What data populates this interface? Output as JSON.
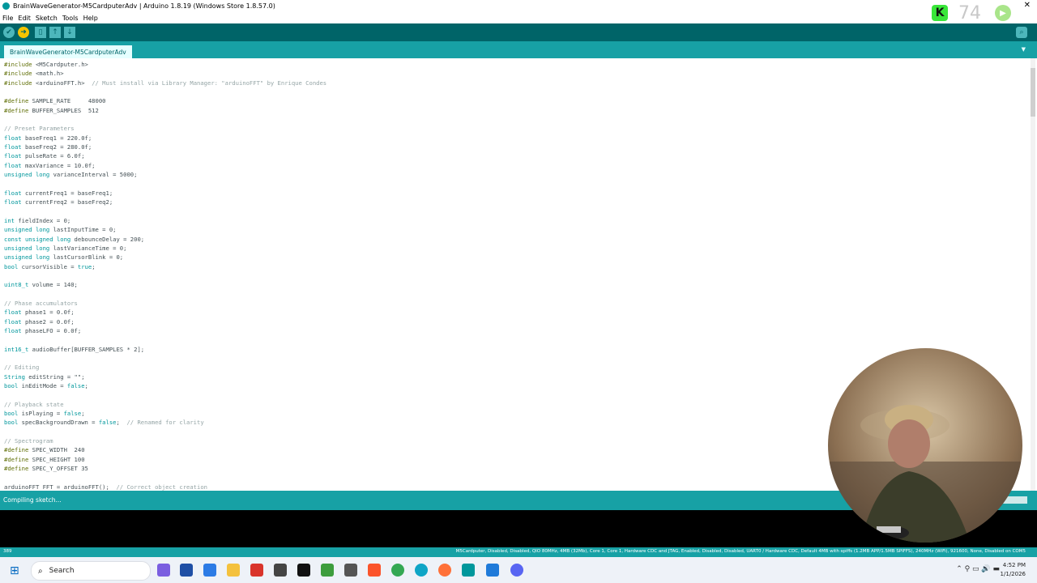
{
  "window": {
    "title": "BrainWaveGenerator-M5CardputerAdv | Arduino 1.8.19 (Windows Store 1.8.57.0)",
    "close_glyph": "✕"
  },
  "menu": [
    "File",
    "Edit",
    "Sketch",
    "Tools",
    "Help"
  ],
  "overlay": {
    "k_label": "K",
    "number": "74"
  },
  "tab": {
    "label": "BrainWaveGenerator-M5CardputerAdv"
  },
  "status": {
    "message": "Compiling sketch..."
  },
  "board_bar": {
    "line": "389",
    "info": "M5Cardputer, Disabled, Disabled, QIO 80MHz, 4MB (32Mb), Core 1, Core 1, Hardware CDC and JTAG, Enabled, Disabled, Disabled, UART0 / Hardware CDC, Default 4MB with spiffs (1.2MB APP/1.5MB SPIFFS), 240MHz (WiFi), 921600, None, Disabled on COM5"
  },
  "taskbar": {
    "search_label": "Search",
    "time": "4:52 PM",
    "date": "1/1/2026"
  },
  "colors": {
    "toolbar": "#006468",
    "tabbar": "#17a1a5",
    "accent": "#00979c",
    "preprocessor": "#5e6d03",
    "comment": "#95a5a6"
  },
  "code_lines": [
    "#include <M5Cardputer.h>",
    "#include <math.h>",
    "#include <arduinoFFT.h>  // Must install via Library Manager: \"arduinoFFT\" by Enrique Condes",
    "",
    "#define SAMPLE_RATE     48000",
    "#define BUFFER_SAMPLES  512",
    "",
    "// Preset Parameters",
    "float baseFreq1 = 220.0f;",
    "float baseFreq2 = 280.0f;",
    "float pulseRate = 6.0f;",
    "float maxVariance = 10.0f;",
    "unsigned long varianceInterval = 5000;",
    "",
    "float currentFreq1 = baseFreq1;",
    "float currentFreq2 = baseFreq2;",
    "",
    "int fieldIndex = 0;",
    "unsigned long lastInputTime = 0;",
    "const unsigned long debounceDelay = 200;",
    "unsigned long lastVarianceTime = 0;",
    "unsigned long lastCursorBlink = 0;",
    "bool cursorVisible = true;",
    "",
    "uint8_t volume = 140;",
    "",
    "// Phase accumulators",
    "float phase1 = 0.0f;",
    "float phase2 = 0.0f;",
    "float phaseLFO = 0.0f;",
    "",
    "int16_t audioBuffer[BUFFER_SAMPLES * 2];",
    "",
    "// Editing",
    "String editString = \"\";",
    "bool inEditMode = false;",
    "",
    "// Playback state",
    "bool isPlaying = false;",
    "bool specBackgroundDrawn = false;  // Renamed for clarity",
    "",
    "// Spectrogram",
    "#define SPEC_WIDTH  240",
    "#define SPEC_HEIGHT 100",
    "#define SPEC_Y_OFFSET 35",
    "",
    "arduinoFFT FFT = arduinoFFT();  // Correct object creation"
  ]
}
